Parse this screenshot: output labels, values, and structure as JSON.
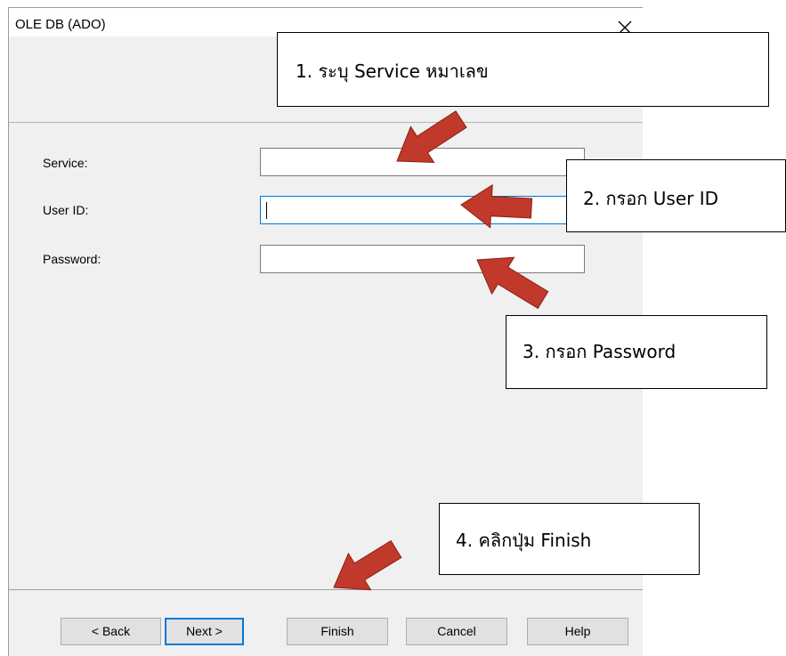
{
  "window": {
    "title": "OLE DB (ADO)",
    "close_icon": "close-icon"
  },
  "form": {
    "fields": [
      {
        "label": "Service:",
        "value": "",
        "focused": false
      },
      {
        "label": "User ID:",
        "value": "",
        "focused": true
      },
      {
        "label": "Password:",
        "value": "",
        "focused": false
      }
    ]
  },
  "buttons": {
    "back": "< Back",
    "next": "Next >",
    "finish": "Finish",
    "cancel": "Cancel",
    "help": "Help"
  },
  "annotations": {
    "step1": "1. ระบุ Service หมาเลข",
    "step2": "2. กรอก User ID",
    "step3": "3. กรอก Password",
    "step4": "4. คลิกปุ่ม Finish",
    "arrow_color": "#c0392b"
  },
  "colors": {
    "dialog_bg": "#f0f0f0",
    "focus_border": "#0078d7",
    "button_bg": "#e1e1e1"
  }
}
